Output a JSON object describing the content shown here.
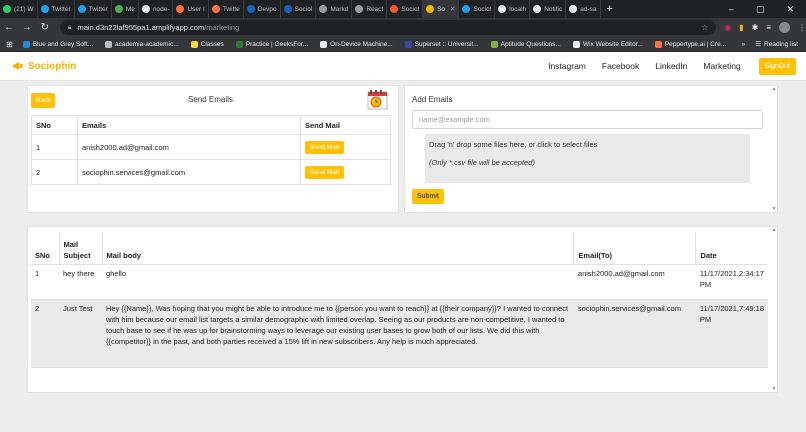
{
  "browser": {
    "tabs": [
      {
        "label": "(21) W",
        "color": "#25d366",
        "active": false
      },
      {
        "label": "Twitter",
        "color": "#1da1f2",
        "active": false
      },
      {
        "label": "Twitter",
        "color": "#1da1f2",
        "active": false
      },
      {
        "label": "Me",
        "color": "#4caf50",
        "active": false
      },
      {
        "label": "node-",
        "color": "#e8eaed",
        "active": false
      },
      {
        "label": "User I",
        "color": "#ff7043",
        "active": false
      },
      {
        "label": "Twitte",
        "color": "#ff7043",
        "active": false
      },
      {
        "label": "Devpo",
        "color": "#1565c0",
        "active": false
      },
      {
        "label": "Sociol",
        "color": "#1565c0",
        "active": false
      },
      {
        "label": "Markd",
        "color": "#9e9e9e",
        "active": false
      },
      {
        "label": "React",
        "color": "#9e9e9e",
        "active": false
      },
      {
        "label": "Sociol",
        "color": "#ff5722",
        "active": false
      },
      {
        "label": "So",
        "color": "#f0b400",
        "active": true
      },
      {
        "label": "Sociol",
        "color": "#1da1f2",
        "active": false
      },
      {
        "label": "localh",
        "color": "#e8eaed",
        "active": false
      },
      {
        "label": "Notific",
        "color": "#e8eaed",
        "active": false
      },
      {
        "label": "ad-sa",
        "color": "#e8eaed",
        "active": false
      }
    ],
    "url_host": "main.d3n22laf955pa1.amplifyapp.com",
    "url_path": "/marketing",
    "bookmarks": [
      {
        "label": "Blue and Grey Soft...",
        "color": "#1e88e5"
      },
      {
        "label": "academia-academic...",
        "color": "#bdbdbd"
      },
      {
        "label": "Classes",
        "color": "#fdd835"
      },
      {
        "label": "Practice | GeeksFor...",
        "color": "#2e7d32"
      },
      {
        "label": "On-Device Machine...",
        "color": "#eeeeee"
      },
      {
        "label": "Superset :: Universit...",
        "color": "#3949ab"
      },
      {
        "label": "Aptitude Questions...",
        "color": "#7cb342"
      },
      {
        "label": "Wix Website Editor...",
        "color": "#eeeeee"
      },
      {
        "label": "Peppertype.ai | Cre...",
        "color": "#ff7043"
      }
    ],
    "reading_list": "Reading list"
  },
  "app": {
    "brand": "Sociophin",
    "nav": [
      "Instagram",
      "Facebook",
      "LinkedIn",
      "Marketing"
    ],
    "signout": "SignOut"
  },
  "send_panel": {
    "back": "Back",
    "title": "Send Emails",
    "headers": [
      "SNo",
      "Emails",
      "Send Mail"
    ],
    "rows": [
      {
        "sno": "1",
        "email": "anish2000.ad@gmail.com",
        "action": "Send Mail"
      },
      {
        "sno": "2",
        "email": "sociophin.services@gmail.com",
        "action": "Send Mail"
      }
    ]
  },
  "add_panel": {
    "title": "Add Emails",
    "placeholder": "name@example.com",
    "drop_text": "Drag 'n' drop some files here, or click to select files",
    "drop_note": "(Only *.csv file will be accepted)",
    "submit": "Submit"
  },
  "history": {
    "headers": [
      "SNo",
      "Mail Subject",
      "Mail body",
      "Email(To)",
      "Date"
    ],
    "rows": [
      {
        "sno": "1",
        "subject": "hey there",
        "body": "ghello",
        "to": "anish2000.ad@gmail.com",
        "date": "11/17/2021,2:34:17 PM"
      },
      {
        "sno": "2",
        "subject": "Just Test",
        "body": "Hey {{Name}}, Was hoping that you might be able to introduce me to {{person you want to reach}} at {{their company}}? I wanted to connect with him because our email list targets a similar demographic with limited overlap. Seeing as our products are non-competitive, I wanted to touch base to see if he was up for brainstorming ways to leverage our existing user bases to grow both of our lists. We did this with {{competitor}} in the past, and both parties received a 15% lift in new subscribers. Any help is much appreciated.",
        "to": "sociophin.services@gmail.com",
        "date": "11/17/2021,7:49:18 PM"
      }
    ]
  },
  "colors": {
    "accent": "#ffc107",
    "brand": "#f0b400"
  }
}
